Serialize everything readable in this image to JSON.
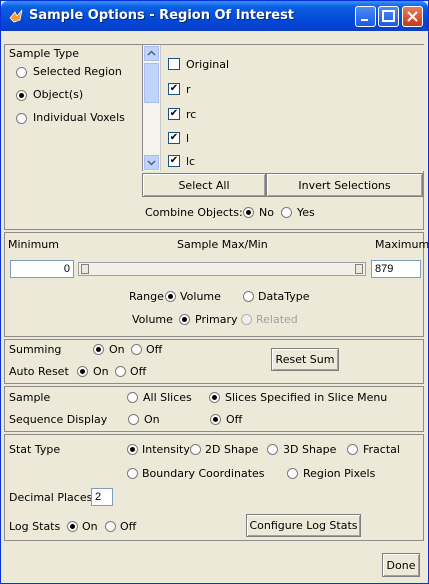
{
  "window": {
    "title": "Sample Options - Region Of Interest"
  },
  "sample_type": {
    "label": "Sample Type",
    "options": [
      "Selected Region",
      "Object(s)",
      "Individual Voxels"
    ],
    "selected": "Object(s)"
  },
  "objects": {
    "items": [
      {
        "label": "Original",
        "checked": false
      },
      {
        "label": "r",
        "checked": true
      },
      {
        "label": "rc",
        "checked": true
      },
      {
        "label": "l",
        "checked": true
      },
      {
        "label": "lc",
        "checked": true
      }
    ],
    "check_mark": "✔",
    "select_all_label": "Select All",
    "invert_label": "Invert Selections",
    "combine_label": "Combine Objects:",
    "combine_no": "No",
    "combine_yes": "Yes",
    "combine_selected": "No"
  },
  "range": {
    "minimum_label": "Minimum",
    "title": "Sample Max/Min",
    "maximum_label": "Maximum",
    "min_value": "0",
    "max_value": "879",
    "range_label": "Range",
    "range_volume": "Volume",
    "range_datatype": "DataType",
    "range_selected": "Volume",
    "volume_label": "Volume",
    "volume_primary": "Primary",
    "volume_related": "Related",
    "volume_selected": "Primary"
  },
  "summing": {
    "label": "Summing",
    "on": "On",
    "off": "Off",
    "selected": "On",
    "auto_reset_label": "Auto Reset",
    "auto_on": "On",
    "auto_off": "Off",
    "auto_selected": "On",
    "reset_sum_label": "Reset Sum"
  },
  "sample": {
    "label": "Sample",
    "all_slices": "All Slices",
    "specified": "Slices Specified in Slice Menu",
    "selected": "Slices Specified in Slice Menu",
    "sequence_label": "Sequence Display",
    "seq_on": "On",
    "seq_off": "Off",
    "seq_selected": "Off"
  },
  "stats": {
    "stat_type_label": "Stat Type",
    "types": [
      "Intensity",
      "2D Shape",
      "3D Shape",
      "Fractal",
      "Boundary Coordinates",
      "Region Pixels"
    ],
    "selected": "Intensity",
    "decimal_label": "Decimal Places",
    "decimal_value": "2",
    "log_label": "Log Stats",
    "log_on": "On",
    "log_off": "Off",
    "log_selected": "On",
    "configure_label": "Configure Log Stats"
  },
  "footer": {
    "done_label": "Done"
  }
}
